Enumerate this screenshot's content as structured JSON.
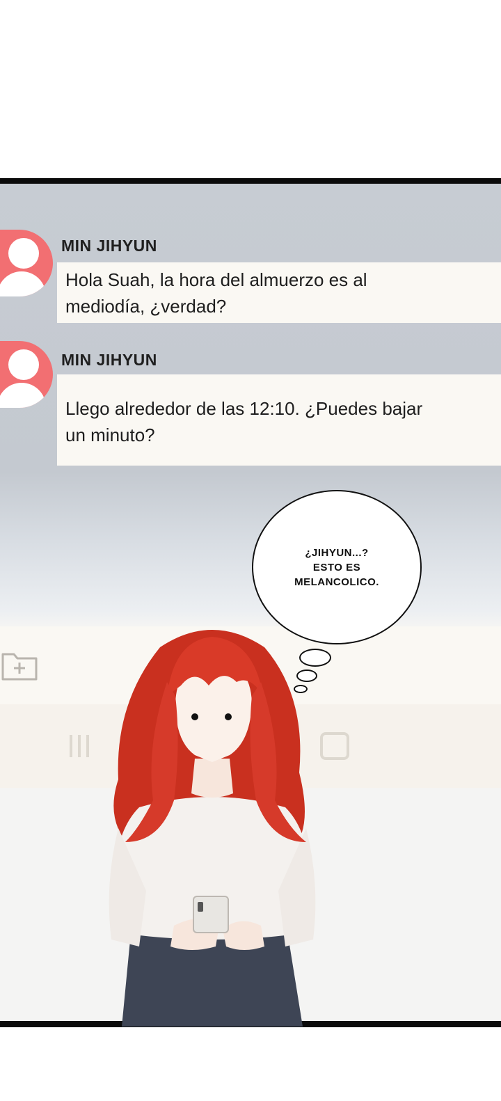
{
  "messages": [
    {
      "sender": "MIN JIHYUN",
      "text_line1": "Hola Suah, la hora del almuerzo es al",
      "text_line2": "mediodía, ¿verdad?"
    },
    {
      "sender": "MIN JIHYUN",
      "text_line1": "Llego alrededor de las 12:10. ¿Puedes bajar",
      "text_line2": "un minuto?"
    }
  ],
  "thought": {
    "line1": "¿JIHYUN...?",
    "line2": "ESTO ES",
    "line3": "MELANCOLICO."
  },
  "icons": {
    "avatar": "person-avatar-icon",
    "attach": "folder-plus-icon",
    "recents": "recent-apps-icon",
    "home": "home-square-icon"
  },
  "colors": {
    "avatar": "#f26f72",
    "chat_background": "#c7ccd3",
    "bubble": "#faf8f3",
    "hair": "#d63a2a"
  }
}
